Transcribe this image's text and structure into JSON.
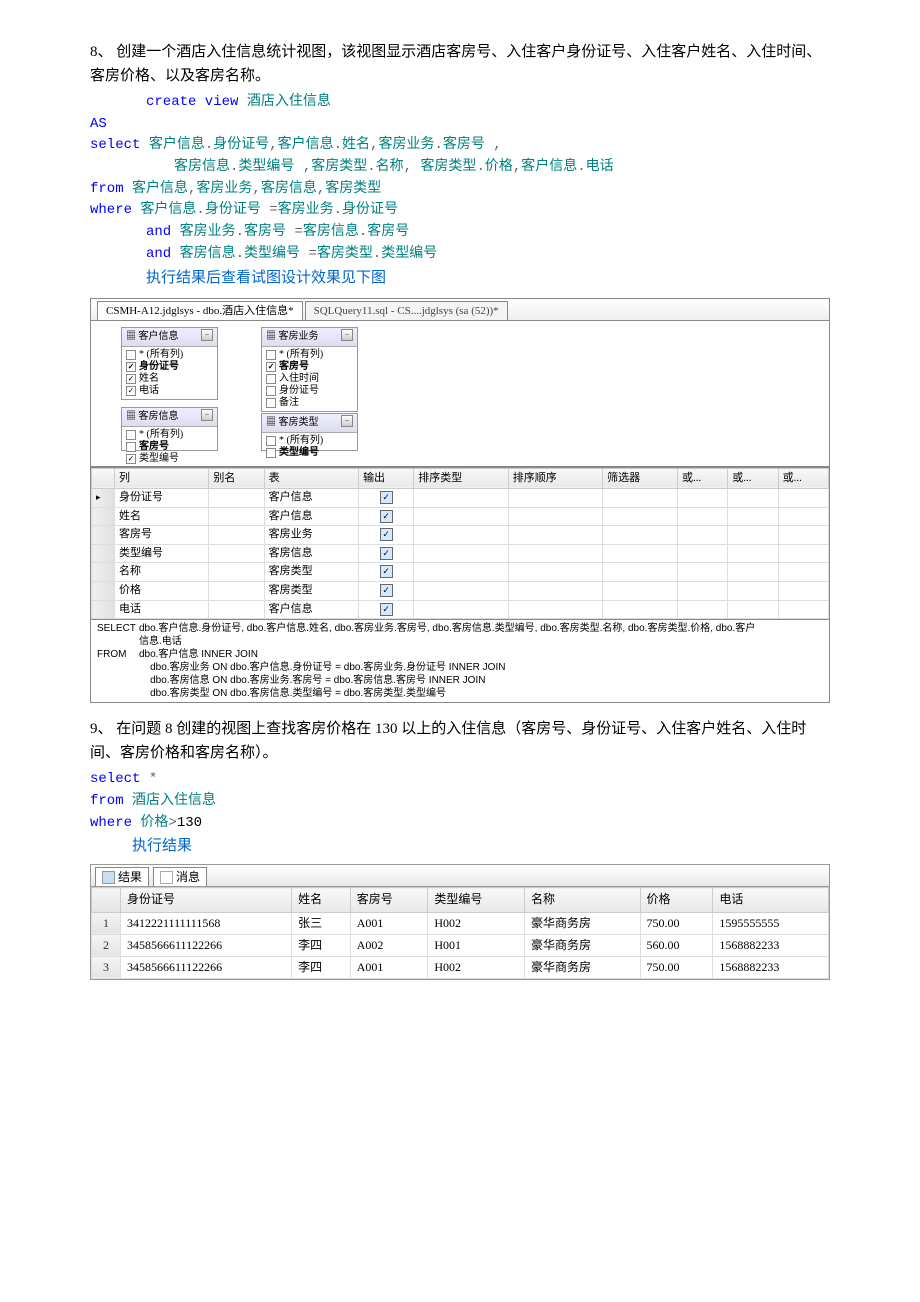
{
  "q8": {
    "text": "8、 创建一个酒店入住信息统计视图，该视图显示酒店客房号、入住客户身份证号、入住客户姓名、入住时间、客房价格、以及客房名称。",
    "code": [
      {
        "indent": 2,
        "tokens": [
          {
            "t": "create view",
            "c": "kw"
          },
          {
            "t": " 酒店入住信息",
            "c": "obj"
          }
        ]
      },
      {
        "indent": 0,
        "tokens": [
          {
            "t": "AS",
            "c": "kw"
          }
        ]
      },
      {
        "indent": 0,
        "tokens": [
          {
            "t": "select",
            "c": "kw"
          },
          {
            "t": " 客户信息",
            "c": "obj"
          },
          {
            "t": ".",
            "c": "op"
          },
          {
            "t": "身份证号",
            "c": "obj"
          },
          {
            "t": ",",
            "c": "op"
          },
          {
            "t": "客户信息",
            "c": "obj"
          },
          {
            "t": ".",
            "c": "op"
          },
          {
            "t": "姓名",
            "c": "obj"
          },
          {
            "t": ",",
            "c": "op"
          },
          {
            "t": "客房业务",
            "c": "obj"
          },
          {
            "t": ".",
            "c": "op"
          },
          {
            "t": "客房号 ",
            "c": "obj"
          },
          {
            "t": ",",
            "c": "op"
          }
        ]
      },
      {
        "indent": 3,
        "tokens": [
          {
            "t": "客房信息",
            "c": "obj"
          },
          {
            "t": ".",
            "c": "op"
          },
          {
            "t": "类型编号 ",
            "c": "obj"
          },
          {
            "t": ",",
            "c": "op"
          },
          {
            "t": "客房类型",
            "c": "obj"
          },
          {
            "t": ".",
            "c": "op"
          },
          {
            "t": "名称",
            "c": "obj"
          },
          {
            "t": ", ",
            "c": "op"
          },
          {
            "t": " 客房类型",
            "c": "obj"
          },
          {
            "t": ".",
            "c": "op"
          },
          {
            "t": "价格",
            "c": "obj"
          },
          {
            "t": ",",
            "c": "op"
          },
          {
            "t": "客户信息",
            "c": "obj"
          },
          {
            "t": ".",
            "c": "op"
          },
          {
            "t": "电话",
            "c": "obj"
          }
        ]
      },
      {
        "indent": 0,
        "tokens": [
          {
            "t": "from  ",
            "c": "kw"
          },
          {
            "t": " 客户信息",
            "c": "obj"
          },
          {
            "t": ",",
            "c": "op"
          },
          {
            "t": "客房业务",
            "c": "obj"
          },
          {
            "t": ",",
            "c": "op"
          },
          {
            "t": "客房信息",
            "c": "obj"
          },
          {
            "t": ",",
            "c": "op"
          },
          {
            "t": "客房类型",
            "c": "obj"
          }
        ]
      },
      {
        "indent": 0,
        "tokens": [
          {
            "t": "where",
            "c": "kw"
          },
          {
            "t": " 客户信息",
            "c": "obj"
          },
          {
            "t": ".",
            "c": "op"
          },
          {
            "t": "身份证号 ",
            "c": "obj"
          },
          {
            "t": "=",
            "c": "op"
          },
          {
            "t": "客房业务",
            "c": "obj"
          },
          {
            "t": ".",
            "c": "op"
          },
          {
            "t": "身份证号",
            "c": "obj"
          }
        ]
      },
      {
        "indent": 2,
        "tokens": [
          {
            "t": "and",
            "c": "kw"
          },
          {
            "t": " 客房业务",
            "c": "obj"
          },
          {
            "t": ".",
            "c": "op"
          },
          {
            "t": "客房号 ",
            "c": "obj"
          },
          {
            "t": "=",
            "c": "op"
          },
          {
            "t": "客房信息",
            "c": "obj"
          },
          {
            "t": ".",
            "c": "op"
          },
          {
            "t": "客房号",
            "c": "obj"
          }
        ]
      },
      {
        "indent": 2,
        "tokens": [
          {
            "t": "and",
            "c": "kw"
          },
          {
            "t": " 客房信息",
            "c": "obj"
          },
          {
            "t": ".",
            "c": "op"
          },
          {
            "t": "类型编号  ",
            "c": "obj"
          },
          {
            "t": "=",
            "c": "op"
          },
          {
            "t": "客房类型",
            "c": "obj"
          },
          {
            "t": ".",
            "c": "op"
          },
          {
            "t": "类型编号",
            "c": "obj"
          }
        ]
      }
    ],
    "result_label": "执行结果后查看试图设计效果见下图"
  },
  "ss": {
    "tabs": [
      "CSMH-A12.jdglsys - dbo.酒店入住信息*",
      "SQLQuery11.sql - CS....jdglsys (sa (52))*"
    ],
    "boxes": {
      "b1": {
        "title": "客户信息",
        "style": "left:30px;top:6px",
        "items": [
          {
            "l": "* (所有列)"
          },
          {
            "l": "身份证号",
            "ck": 1,
            "b": 1
          },
          {
            "l": "姓名",
            "ck": 1
          },
          {
            "l": "电话",
            "ck": 1
          }
        ]
      },
      "b2": {
        "title": "客房业务",
        "style": "left:170px;top:6px",
        "items": [
          {
            "l": "* (所有列)"
          },
          {
            "l": "客房号",
            "ck": 1,
            "b": 1
          },
          {
            "l": "入住时间"
          },
          {
            "l": "身份证号"
          },
          {
            "l": "备注"
          }
        ]
      },
      "b3": {
        "title": "客房信息",
        "style": "left:30px;top:86px;height:42px",
        "items": [
          {
            "l": "* (所有列)"
          },
          {
            "l": "客房号",
            "b": 1
          },
          {
            "l": "类型编号",
            "ck": 1
          }
        ]
      },
      "b4": {
        "title": "客房类型",
        "style": "left:170px;top:92px;height:36px",
        "items": [
          {
            "l": "* (所有列)"
          },
          {
            "l": "类型编号",
            "b": 1
          }
        ]
      }
    },
    "grid_headers": [
      "列",
      "别名",
      "表",
      "输出",
      "排序类型",
      "排序顺序",
      "筛选器",
      "或...",
      "或...",
      "或..."
    ],
    "grid_rows": [
      {
        "c": "身份证号",
        "t": "客户信息",
        "o": 1
      },
      {
        "c": "姓名",
        "t": "客户信息",
        "o": 1
      },
      {
        "c": "客房号",
        "t": "客房业务",
        "o": 1
      },
      {
        "c": "类型编号",
        "t": "客房信息",
        "o": 1
      },
      {
        "c": "名称",
        "t": "客房类型",
        "o": 1
      },
      {
        "c": "价格",
        "t": "客房类型",
        "o": 1
      },
      {
        "c": "电话",
        "t": "客户信息",
        "o": 1
      }
    ],
    "sql": {
      "select": "dbo.客户信息.身份证号, dbo.客户信息.姓名, dbo.客房业务.客房号, dbo.客房信息.类型编号, dbo.客房类型.名称, dbo.客房类型.价格, dbo.客户信息.电话",
      "from": [
        "dbo.客户信息 INNER JOIN",
        "dbo.客房业务 ON dbo.客户信息.身份证号 = dbo.客房业务.身份证号 INNER JOIN",
        "dbo.客房信息 ON dbo.客房业务.客房号 = dbo.客房信息.客房号 INNER JOIN",
        "dbo.客房类型 ON dbo.客房信息.类型编号 = dbo.客房类型.类型编号"
      ]
    }
  },
  "q9": {
    "text": "9、 在问题 8 创建的视图上查找客房价格在 130 以上的入住信息（客房号、身份证号、入住客户姓名、入住时间、客房价格和客房名称）。",
    "code": [
      {
        "indent": 0,
        "tokens": [
          {
            "t": "select",
            "c": "kw"
          },
          {
            "t": " *",
            "c": "op"
          }
        ]
      },
      {
        "indent": 0,
        "tokens": [
          {
            "t": "from",
            "c": "kw"
          },
          {
            "t": " 酒店入住信息",
            "c": "obj"
          }
        ]
      },
      {
        "indent": 0,
        "tokens": [
          {
            "t": "where",
            "c": "kw"
          },
          {
            "t": " 价格",
            "c": "obj"
          },
          {
            "t": ">",
            "c": "op"
          },
          {
            "t": "130",
            "c": ""
          }
        ]
      }
    ],
    "result_label": "执行结果",
    "res_tabs": [
      "结果",
      "消息"
    ],
    "headers": [
      "身份证号",
      "姓名",
      "客房号",
      "类型编号",
      "名称",
      "价格",
      "电话"
    ],
    "rows": [
      [
        "3412221111111568",
        "张三",
        "A001",
        "H002",
        "豪华商务房",
        "750.00",
        "1595555555"
      ],
      [
        "3458566611122266",
        "李四",
        "A002",
        "H001",
        "豪华商务房",
        "560.00",
        "1568882233"
      ],
      [
        "3458566611122266",
        "李四",
        "A001",
        "H002",
        "豪华商务房",
        "750.00",
        "1568882233"
      ]
    ]
  }
}
